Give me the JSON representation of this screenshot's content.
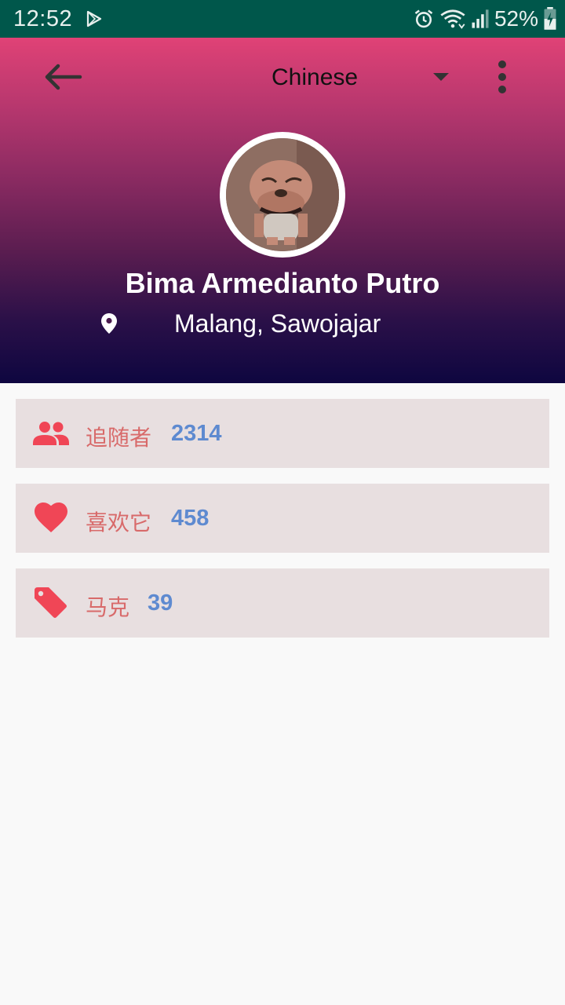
{
  "status_bar": {
    "time": "12:52",
    "battery_percent": "52%",
    "icons": [
      "play-store-icon",
      "alarm-icon",
      "wifi-icon",
      "signal-icon",
      "battery-charging-icon"
    ]
  },
  "toolbar": {
    "language": "Chinese",
    "icons": [
      "arrow-back-icon",
      "dropdown-arrow-icon",
      "more-vert-icon"
    ]
  },
  "profile": {
    "name": "Bima Armedianto Putro",
    "location": "Malang, Sawojajar"
  },
  "stats": [
    {
      "label": "追随者",
      "value": "2314",
      "icon": "people-icon"
    },
    {
      "label": "喜欢它",
      "value": "458",
      "icon": "heart-icon"
    },
    {
      "label": "马克",
      "value": "39",
      "icon": "tag-icon"
    }
  ],
  "colors": {
    "status_bar": "#00574b",
    "header_top": "#e04276",
    "header_bottom": "#0e0640",
    "stat_card": "#e8dfe0",
    "stat_label": "#d86a6a",
    "stat_value": "#5e8ad0",
    "icon_accent": "#f04656"
  }
}
